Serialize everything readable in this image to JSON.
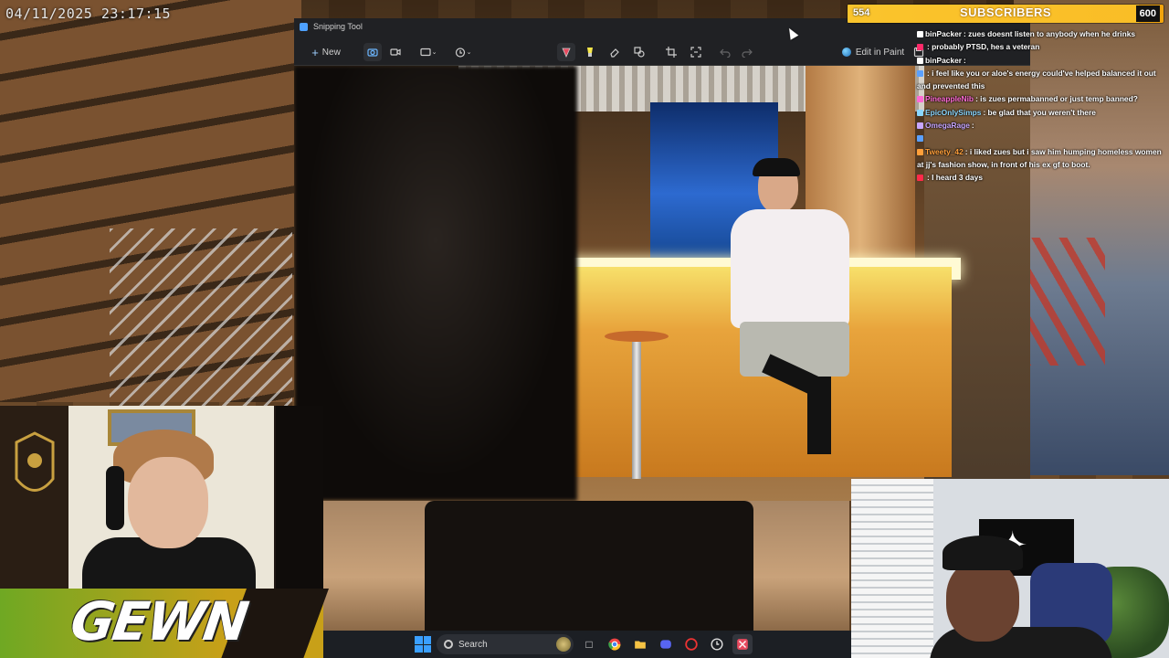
{
  "overlay": {
    "timestamp": "04/11/2025 23:17:15"
  },
  "snipping_tool": {
    "title": "Snipping Tool",
    "new_label": "New",
    "edit_in_paint_label": "Edit in Paint",
    "tools": [
      "camera-icon",
      "video-icon",
      "rectangle-mode-icon",
      "timer-icon",
      "pen-icon",
      "highlighter-icon",
      "eraser-icon",
      "shapes-icon",
      "crop-icon",
      "text-actions-icon",
      "undo-icon",
      "redo-icon",
      "save-icon"
    ]
  },
  "subscriber_goal": {
    "current": "554",
    "label": "SUBSCRIBERS",
    "goal": "600",
    "progress": 0.923,
    "color": "#f4b41a"
  },
  "chat": {
    "messages": [
      {
        "user": "binPacker",
        "text": ": zues doesnt listen to anybody when he drinks",
        "color": "#ffffff"
      },
      {
        "user": "",
        "text": ": probably PTSD, hes a veteran",
        "color": "#ff2a6a"
      },
      {
        "user": "binPacker",
        "text": ":",
        "color": "#ffffff"
      },
      {
        "user": "",
        "text": ": i feel like you or aloe's energy could've helped balanced it out and prevented this",
        "color": "#5aa0ff"
      },
      {
        "user": "PineappleNib",
        "text": ": is zues permabanned or just temp banned?",
        "color": "#ff6ad5"
      },
      {
        "user": "EpicOnlySimps",
        "text": ": be glad that you weren't there",
        "color": "#8ad7ff"
      },
      {
        "user": "OmegaRage",
        "text": ":",
        "color": "#c7a6ff"
      },
      {
        "user": "",
        "text": "",
        "color": "#5aa0ff"
      },
      {
        "user": "Tweety_42",
        "text": ": i liked zues but i saw him humping homeless women at jj's fashion show, in front of his ex gf to boot.",
        "color": "#ff9f3a"
      },
      {
        "user": "",
        "text": ": I heard 3 days",
        "color": "#ff2a4a"
      }
    ]
  },
  "branding": {
    "logo_text": "GEWN"
  },
  "taskbar": {
    "search_placeholder": "Search",
    "apps": [
      "file-icon",
      "chrome-icon",
      "folder-icon",
      "discord-icon",
      "app-icon",
      "clock-icon",
      "snipping-tool-icon"
    ]
  }
}
